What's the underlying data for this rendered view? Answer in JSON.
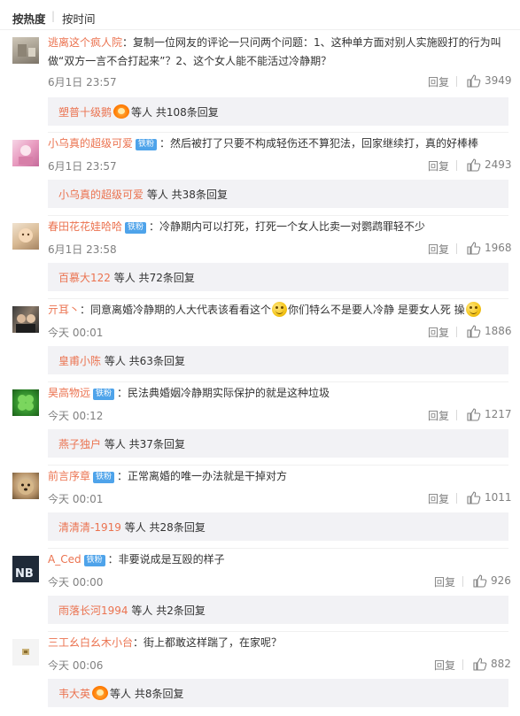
{
  "sort": {
    "hot": "按热度",
    "separator": "|",
    "time": "按时间"
  },
  "reply_label": "回复",
  "sub_suffix_prefix": "等人 共",
  "sub_suffix_suffix": "条回复",
  "colors": {
    "username": "#eb7350",
    "badge": "#4ea3ea",
    "sub_bg": "#f2f2f5",
    "meta": "#808080"
  },
  "comments": [
    {
      "user": "逃离这个疯人院",
      "badge": "",
      "text_line1": "：复制一位网友的评论一只问两个问题：1、这种单方面对别人实施殴打的行为叫",
      "text_line2": "做“双方一言不合打起来”？2、这个女人能不能活过冷静期？",
      "time": "6月1日 23:57",
      "likes": "3949",
      "sub_user": "塑普十级鹅",
      "sub_count": "108"
    },
    {
      "user": "小乌真的超级可爱",
      "badge": "铁粉",
      "text_line1": "：然后被打了只要不构成轻伤还不算犯法，回家继续打，真的好棒棒",
      "time": "6月1日 23:57",
      "likes": "2493",
      "sub_user": "小乌真的超级可爱",
      "sub_count": "38"
    },
    {
      "user": "春田花花娃哈哈",
      "badge": "铁粉",
      "text_line1": "：冷静期内可以打死，打死一个女人比卖一对鹦鹉罪轻不少",
      "time": "6月1日 23:58",
      "likes": "1968",
      "sub_user": "百慕大122",
      "sub_count": "72"
    },
    {
      "user": "亓耳丶",
      "badge": "",
      "text_part1": "：同意离婚冷静期的人大代表该看看这个",
      "text_part2": "你们特么不是要人冷静 是要女人死 操",
      "time": "今天 00:01",
      "likes": "1886",
      "sub_user": "皇甫小陈",
      "sub_count": "63"
    },
    {
      "user": "昊高物远",
      "badge": "铁粉",
      "text_line1": "：民法典婚姻冷静期实际保护的就是这种垃圾",
      "time": "今天 00:12",
      "likes": "1217",
      "sub_user": "燕子独户",
      "sub_count": "37"
    },
    {
      "user": "前言序章",
      "badge": "铁粉",
      "text_line1": "：正常离婚的唯一办法就是干掉对方",
      "time": "今天 00:01",
      "likes": "1011",
      "sub_user": "清清清-1919",
      "sub_count": "28"
    },
    {
      "user": "A_Ced",
      "badge": "铁粉",
      "text_line1": "：非要说成是互殴的样子",
      "time": "今天 00:00",
      "likes": "926",
      "sub_user": "雨落长河1994",
      "sub_count": "2"
    },
    {
      "user": "三工幺白幺木小台",
      "badge": "",
      "text_line1": "：街上都敢这样踹了，在家呢？",
      "time": "今天 00:06",
      "likes": "882",
      "sub_user": "韦大英",
      "sub_count": "8"
    }
  ]
}
